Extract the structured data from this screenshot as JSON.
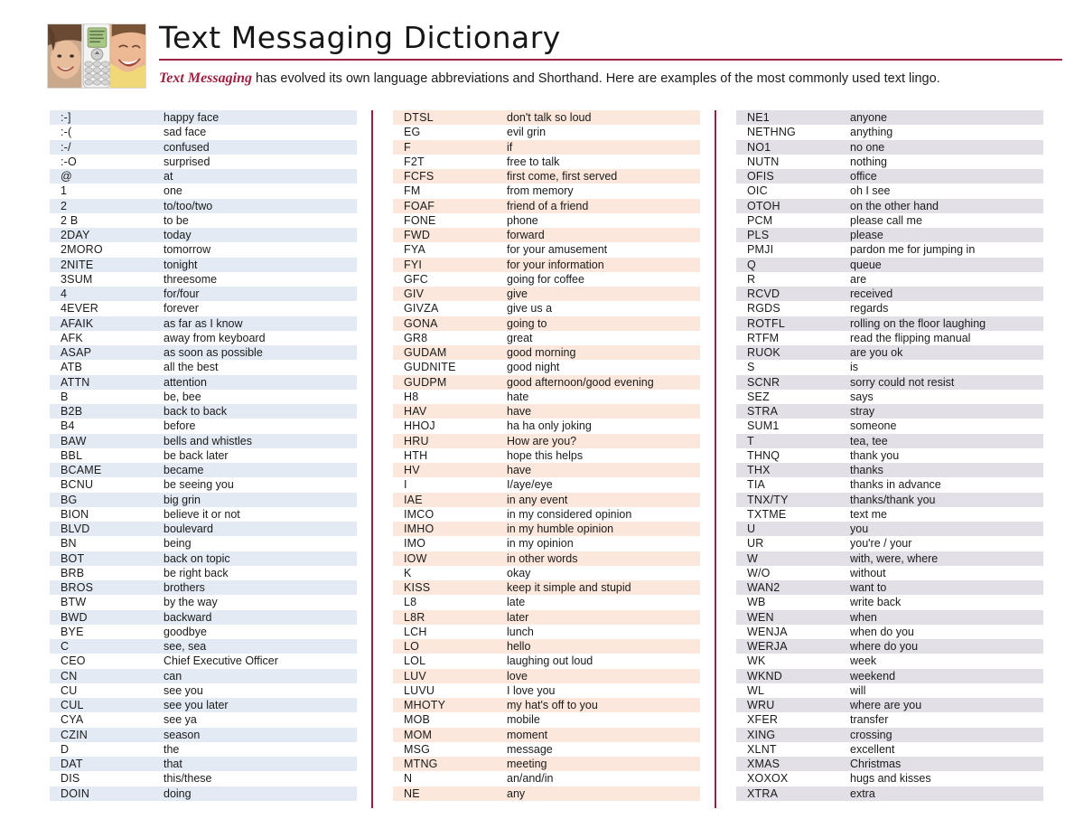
{
  "header": {
    "title": "Text Messaging Dictionary",
    "subtitle_emph": "Text Messaging",
    "subtitle_rest": " has evolved its own language abbreviations and Shorthand. Here are examples of the most commonly used text lingo.",
    "photo_alt": "two laughing women with a mobile phone",
    "accent_color": "#9b2242",
    "divider_color": "#8e2248"
  },
  "columns": [
    {
      "id": "column-1",
      "stripe_color": "#e3eaf3",
      "entries": [
        {
          "abbr": ":-]",
          "meaning": "happy face"
        },
        {
          "abbr": ":-(",
          "meaning": "sad face"
        },
        {
          "abbr": ":-/",
          "meaning": "confused"
        },
        {
          "abbr": ":-O",
          "meaning": "surprised"
        },
        {
          "abbr": "@",
          "meaning": "at"
        },
        {
          "abbr": "1",
          "meaning": "one"
        },
        {
          "abbr": "2",
          "meaning": "to/too/two"
        },
        {
          "abbr": "2 B",
          "meaning": "to be"
        },
        {
          "abbr": "2DAY",
          "meaning": "today"
        },
        {
          "abbr": "2MORO",
          "meaning": "tomorrow"
        },
        {
          "abbr": "2NITE",
          "meaning": "tonight"
        },
        {
          "abbr": "3SUM",
          "meaning": "threesome"
        },
        {
          "abbr": "4",
          "meaning": "for/four"
        },
        {
          "abbr": "4EVER",
          "meaning": "forever"
        },
        {
          "abbr": "AFAIK",
          "meaning": "as far as I know"
        },
        {
          "abbr": "AFK",
          "meaning": "away from keyboard"
        },
        {
          "abbr": "ASAP",
          "meaning": "as soon as possible"
        },
        {
          "abbr": "ATB",
          "meaning": "all the best"
        },
        {
          "abbr": "ATTN",
          "meaning": "attention"
        },
        {
          "abbr": "B",
          "meaning": "be, bee"
        },
        {
          "abbr": "B2B",
          "meaning": "back to back"
        },
        {
          "abbr": "B4",
          "meaning": "before"
        },
        {
          "abbr": "BAW",
          "meaning": "bells and whistles"
        },
        {
          "abbr": "BBL",
          "meaning": "be back later"
        },
        {
          "abbr": "BCAME",
          "meaning": "became"
        },
        {
          "abbr": "BCNU",
          "meaning": "be seeing you"
        },
        {
          "abbr": "BG",
          "meaning": "big grin"
        },
        {
          "abbr": "BION",
          "meaning": "believe it or not"
        },
        {
          "abbr": "BLVD",
          "meaning": "boulevard"
        },
        {
          "abbr": "BN",
          "meaning": "being"
        },
        {
          "abbr": "BOT",
          "meaning": "back on topic"
        },
        {
          "abbr": "BRB",
          "meaning": "be right back"
        },
        {
          "abbr": "BROS",
          "meaning": "brothers"
        },
        {
          "abbr": "BTW",
          "meaning": "by the way"
        },
        {
          "abbr": "BWD",
          "meaning": "backward"
        },
        {
          "abbr": "BYE",
          "meaning": "goodbye"
        },
        {
          "abbr": "C",
          "meaning": "see, sea"
        },
        {
          "abbr": "CEO",
          "meaning": "Chief Executive Officer"
        },
        {
          "abbr": "CN",
          "meaning": "can"
        },
        {
          "abbr": "CU",
          "meaning": "see you"
        },
        {
          "abbr": "CUL",
          "meaning": "see you later"
        },
        {
          "abbr": "CYA",
          "meaning": "see ya"
        },
        {
          "abbr": "CZIN",
          "meaning": "season"
        },
        {
          "abbr": "D",
          "meaning": "the"
        },
        {
          "abbr": "DAT",
          "meaning": "that"
        },
        {
          "abbr": "DIS",
          "meaning": "this/these"
        },
        {
          "abbr": "DOIN",
          "meaning": "doing"
        }
      ]
    },
    {
      "id": "column-2",
      "stripe_color": "#fbe7db",
      "entries": [
        {
          "abbr": "DTSL",
          "meaning": "don't talk so loud"
        },
        {
          "abbr": "EG",
          "meaning": "evil grin"
        },
        {
          "abbr": "F",
          "meaning": "if"
        },
        {
          "abbr": "F2T",
          "meaning": "free to talk"
        },
        {
          "abbr": "FCFS",
          "meaning": "first come, first served"
        },
        {
          "abbr": "FM",
          "meaning": "from memory"
        },
        {
          "abbr": "FOAF",
          "meaning": "friend of a friend"
        },
        {
          "abbr": "FONE",
          "meaning": "phone"
        },
        {
          "abbr": "FWD",
          "meaning": "forward"
        },
        {
          "abbr": "FYA",
          "meaning": "for your amusement"
        },
        {
          "abbr": "FYI",
          "meaning": "for your information"
        },
        {
          "abbr": "GFC",
          "meaning": "going for coffee"
        },
        {
          "abbr": "GIV",
          "meaning": "give"
        },
        {
          "abbr": "GIVZA",
          "meaning": "give us a"
        },
        {
          "abbr": "GONA",
          "meaning": "going to"
        },
        {
          "abbr": "GR8",
          "meaning": "great"
        },
        {
          "abbr": "GUDAM",
          "meaning": "good morning"
        },
        {
          "abbr": "GUDNITE",
          "meaning": "good night"
        },
        {
          "abbr": "GUDPM",
          "meaning": "good afternoon/good evening"
        },
        {
          "abbr": "H8",
          "meaning": "hate"
        },
        {
          "abbr": "HAV",
          "meaning": "have"
        },
        {
          "abbr": "HHOJ",
          "meaning": "ha ha only joking"
        },
        {
          "abbr": "HRU",
          "meaning": "How are you?"
        },
        {
          "abbr": "HTH",
          "meaning": "hope this helps"
        },
        {
          "abbr": "HV",
          "meaning": "have"
        },
        {
          "abbr": "I",
          "meaning": "I/aye/eye"
        },
        {
          "abbr": "IAE",
          "meaning": "in any event"
        },
        {
          "abbr": "IMCO",
          "meaning": "in my considered opinion"
        },
        {
          "abbr": "IMHO",
          "meaning": "in my humble opinion"
        },
        {
          "abbr": "IMO",
          "meaning": "in my opinion"
        },
        {
          "abbr": "IOW",
          "meaning": "in other words"
        },
        {
          "abbr": "K",
          "meaning": "okay"
        },
        {
          "abbr": "KISS",
          "meaning": "keep it simple and stupid"
        },
        {
          "abbr": "L8",
          "meaning": "late"
        },
        {
          "abbr": "L8R",
          "meaning": "later"
        },
        {
          "abbr": "LCH",
          "meaning": "lunch"
        },
        {
          "abbr": "LO",
          "meaning": "hello"
        },
        {
          "abbr": "LOL",
          "meaning": "laughing out loud"
        },
        {
          "abbr": "LUV",
          "meaning": "love"
        },
        {
          "abbr": "LUVU",
          "meaning": "I love you"
        },
        {
          "abbr": "MHOTY",
          "meaning": "my hat's off to you"
        },
        {
          "abbr": "MOB",
          "meaning": "mobile"
        },
        {
          "abbr": "MOM",
          "meaning": "moment"
        },
        {
          "abbr": "MSG",
          "meaning": "message"
        },
        {
          "abbr": "MTNG",
          "meaning": "meeting"
        },
        {
          "abbr": "N",
          "meaning": "an/and/in"
        },
        {
          "abbr": "NE",
          "meaning": "any"
        }
      ]
    },
    {
      "id": "column-3",
      "stripe_color": "#e2e0e6",
      "entries": [
        {
          "abbr": "NE1",
          "meaning": "anyone"
        },
        {
          "abbr": "NETHNG",
          "meaning": "anything"
        },
        {
          "abbr": "NO1",
          "meaning": "no one"
        },
        {
          "abbr": "NUTN",
          "meaning": "nothing"
        },
        {
          "abbr": "OFIS",
          "meaning": "office"
        },
        {
          "abbr": "OIC",
          "meaning": "oh I see"
        },
        {
          "abbr": "OTOH",
          "meaning": "on the other hand"
        },
        {
          "abbr": "PCM",
          "meaning": "please call me"
        },
        {
          "abbr": "PLS",
          "meaning": "please"
        },
        {
          "abbr": "PMJI",
          "meaning": "pardon me for jumping in"
        },
        {
          "abbr": "Q",
          "meaning": "queue"
        },
        {
          "abbr": "R",
          "meaning": "are"
        },
        {
          "abbr": "RCVD",
          "meaning": "received"
        },
        {
          "abbr": "RGDS",
          "meaning": "regards"
        },
        {
          "abbr": "ROTFL",
          "meaning": "rolling on the floor laughing"
        },
        {
          "abbr": "RTFM",
          "meaning": "read the flipping manual"
        },
        {
          "abbr": "RUOK",
          "meaning": "are you ok"
        },
        {
          "abbr": "S",
          "meaning": "is"
        },
        {
          "abbr": "SCNR",
          "meaning": "sorry could not resist"
        },
        {
          "abbr": "SEZ",
          "meaning": "says"
        },
        {
          "abbr": "STRA",
          "meaning": "stray"
        },
        {
          "abbr": "SUM1",
          "meaning": "someone"
        },
        {
          "abbr": "T",
          "meaning": "tea, tee"
        },
        {
          "abbr": "THNQ",
          "meaning": "thank you"
        },
        {
          "abbr": "THX",
          "meaning": "thanks"
        },
        {
          "abbr": "TIA",
          "meaning": "thanks in advance"
        },
        {
          "abbr": "TNX/TY",
          "meaning": "thanks/thank you"
        },
        {
          "abbr": "TXTME",
          "meaning": "text me"
        },
        {
          "abbr": "U",
          "meaning": "you"
        },
        {
          "abbr": "UR",
          "meaning": "you're / your"
        },
        {
          "abbr": "W",
          "meaning": "with, were, where"
        },
        {
          "abbr": "W/O",
          "meaning": "without"
        },
        {
          "abbr": "WAN2",
          "meaning": "want to"
        },
        {
          "abbr": "WB",
          "meaning": "write back"
        },
        {
          "abbr": "WEN",
          "meaning": "when"
        },
        {
          "abbr": "WENJA",
          "meaning": "when do you"
        },
        {
          "abbr": "WERJA",
          "meaning": "where do you"
        },
        {
          "abbr": "WK",
          "meaning": "week"
        },
        {
          "abbr": "WKND",
          "meaning": "weekend"
        },
        {
          "abbr": "WL",
          "meaning": "will"
        },
        {
          "abbr": "WRU",
          "meaning": "where are you"
        },
        {
          "abbr": "XFER",
          "meaning": "transfer"
        },
        {
          "abbr": "XING",
          "meaning": "crossing"
        },
        {
          "abbr": "XLNT",
          "meaning": "excellent"
        },
        {
          "abbr": "XMAS",
          "meaning": "Christmas"
        },
        {
          "abbr": "XOXOX",
          "meaning": "hugs and kisses"
        },
        {
          "abbr": "XTRA",
          "meaning": "extra"
        }
      ]
    }
  ]
}
